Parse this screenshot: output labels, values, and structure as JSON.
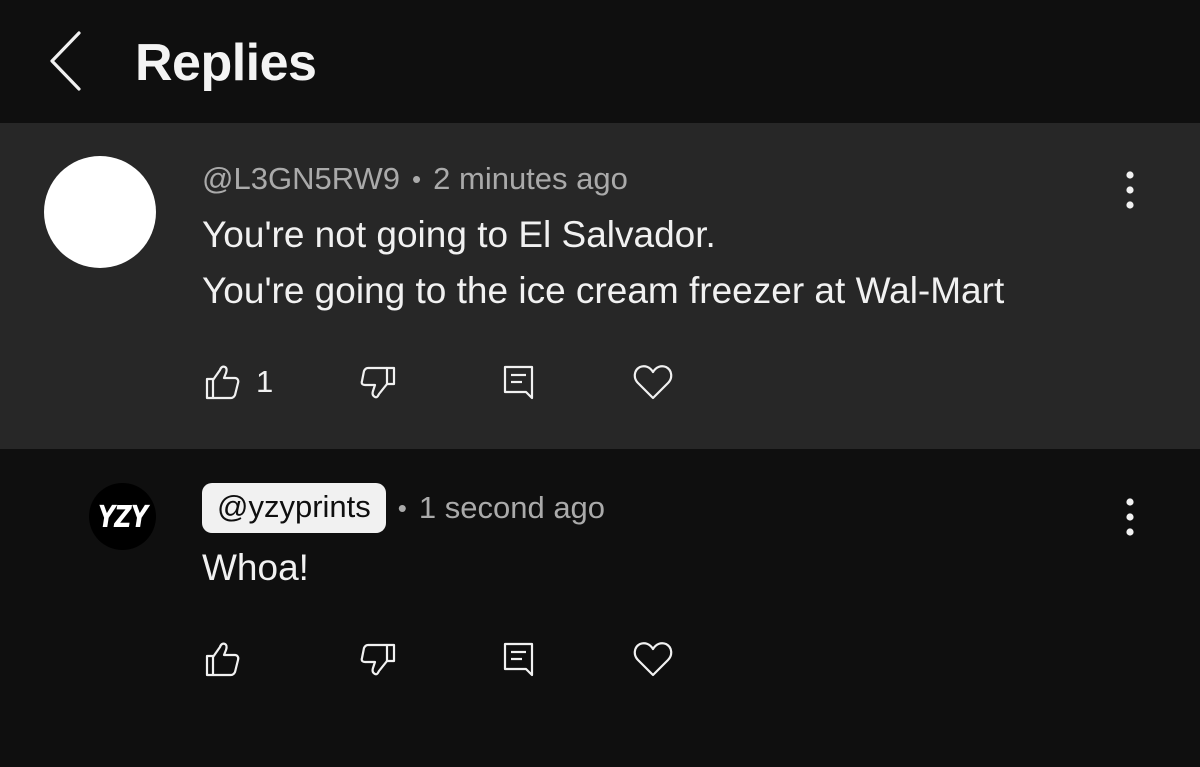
{
  "header": {
    "title": "Replies",
    "back_icon": "chevron-left-icon"
  },
  "comments": [
    {
      "author": "@L3GN5RW9",
      "separator": "•",
      "time": "2 minutes ago",
      "lines": [
        "You're not going to El Salvador.",
        "You're going to the ice cream freezer at Wal-Mart"
      ],
      "like_count": "1",
      "avatar": {
        "color": "#ffffff"
      },
      "highlighted": true
    },
    {
      "author": "@yzyprints",
      "separator": "•",
      "time": "1 second ago",
      "lines": [
        "Whoa!"
      ],
      "like_count": "",
      "avatar": {
        "color": "#000000",
        "logo_text": "YZY"
      },
      "author_is_highlighted_chip": true
    }
  ],
  "icons": {
    "like": "thumbs-up-icon",
    "dislike": "thumbs-down-icon",
    "reply": "reply-comment-icon",
    "heart": "heart-icon",
    "more": "more-vertical-icon"
  },
  "colors": {
    "background": "#0f0f0f",
    "highlight_background": "#272727",
    "primary_text": "#f1f1f1",
    "secondary_text": "#aaaaaa"
  }
}
